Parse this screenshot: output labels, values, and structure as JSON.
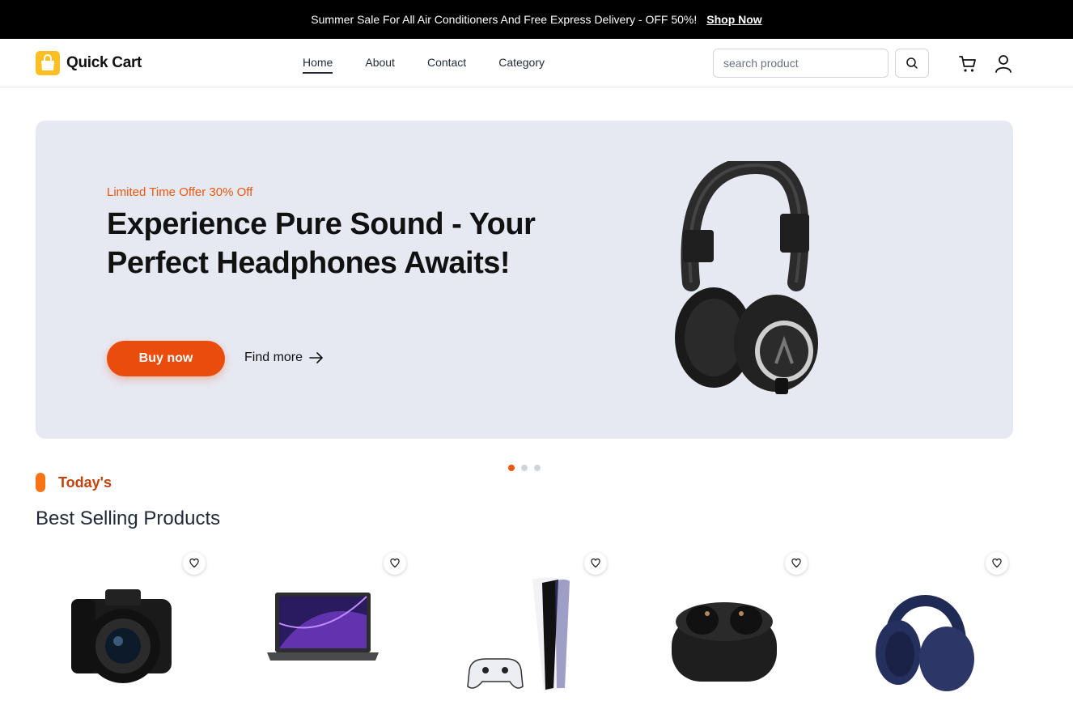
{
  "promo": {
    "text": "Summer Sale For All Air Conditioners And Free Express Delivery - OFF 50%!",
    "link": "Shop Now"
  },
  "brand": {
    "name": "Quick Cart",
    "logo_icon": "shopping-bag-icon",
    "logo_color": "#fbbf24"
  },
  "nav": {
    "items": [
      "Home",
      "About",
      "Contact",
      "Category"
    ],
    "active": "Home"
  },
  "search": {
    "placeholder": "search product",
    "icon": "search-icon"
  },
  "header_icons": {
    "cart": "cart-icon",
    "account": "user-icon"
  },
  "hero": {
    "offer": "Limited Time Offer 30% Off",
    "title": "Experience Pure Sound - Your Perfect Headphones Awaits!",
    "buy_label": "Buy now",
    "find_more_label": "Find more",
    "image": "headphones-image",
    "background": "#e6e9f2",
    "accent": "#ea4c0c"
  },
  "carousel": {
    "total_slides": 3,
    "active_slide": 1
  },
  "section": {
    "label": "Today's",
    "title": "Best Selling Products"
  },
  "products": [
    {
      "image": "camera-image"
    },
    {
      "image": "laptop-image"
    },
    {
      "image": "game-console-image"
    },
    {
      "image": "earbuds-image"
    },
    {
      "image": "headphones-image"
    }
  ]
}
